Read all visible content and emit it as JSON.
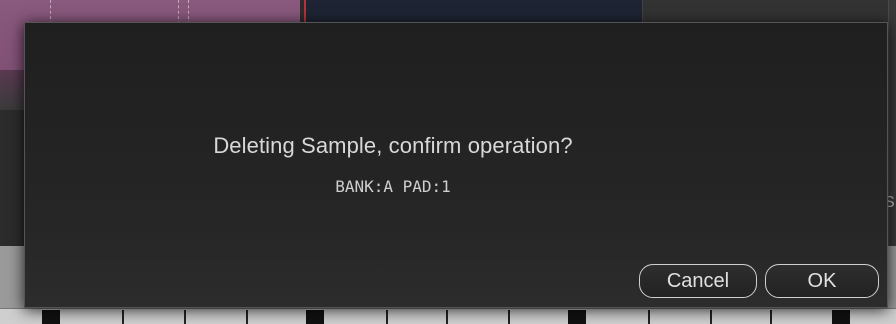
{
  "dialog": {
    "message": "Deleting Sample, confirm operation?",
    "detail": "BANK:A PAD:1",
    "buttons": {
      "cancel": "Cancel",
      "ok": "OK"
    }
  },
  "background": {
    "right_edge_letter": "S"
  },
  "colors": {
    "dialog_bg": "#232323",
    "text": "#d8d8d8",
    "button_border": "#d0d0d0",
    "timeline_pink": "#8a5a7e"
  }
}
